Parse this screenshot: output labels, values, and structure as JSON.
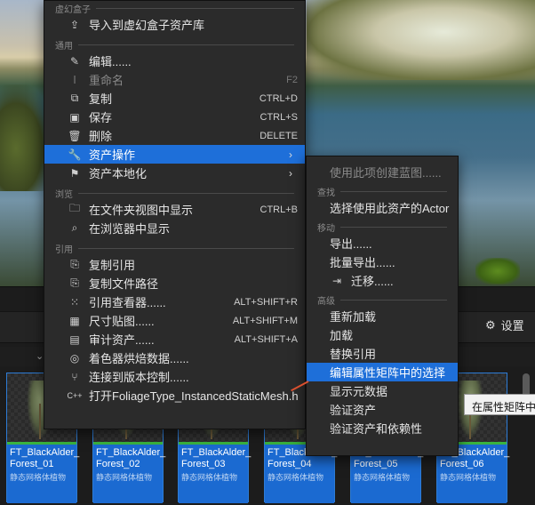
{
  "background": {
    "settings_label": "设置"
  },
  "main_menu": {
    "sections": [
      {
        "title": "虚幻盒子",
        "items": [
          {
            "label": "导入到虚幻盒子资产库",
            "shortcut": "",
            "icon": "import-icon"
          }
        ]
      },
      {
        "title": "通用",
        "items": [
          {
            "label": "编辑......",
            "shortcut": "",
            "icon": "edit-icon"
          },
          {
            "label": "重命名",
            "shortcut": "F2",
            "icon": "rename-icon"
          },
          {
            "label": "复制",
            "shortcut": "CTRL+D",
            "icon": "duplicate-icon"
          },
          {
            "label": "保存",
            "shortcut": "CTRL+S",
            "icon": "save-icon"
          },
          {
            "label": "删除",
            "shortcut": "DELETE",
            "icon": "delete-icon"
          },
          {
            "label": "资产操作",
            "shortcut": "",
            "icon": "wrench-icon"
          },
          {
            "label": "资产本地化",
            "shortcut": "",
            "icon": "flag-icon"
          }
        ]
      },
      {
        "title": "浏览",
        "items": [
          {
            "label": "在文件夹视图中显示",
            "shortcut": "CTRL+B",
            "icon": "folder-search-icon"
          },
          {
            "label": "在浏览器中显示",
            "shortcut": "",
            "icon": "browser-search-icon"
          }
        ]
      },
      {
        "title": "引用",
        "items": [
          {
            "label": "复制引用",
            "shortcut": "",
            "icon": "copy-reference-icon"
          },
          {
            "label": "复制文件路径",
            "shortcut": "",
            "icon": "copy-path-icon"
          },
          {
            "label": "引用查看器......",
            "shortcut": "ALT+SHIFT+R",
            "icon": "reference-viewer-icon"
          },
          {
            "label": "尺寸贴图......",
            "shortcut": "ALT+SHIFT+M",
            "icon": "size-map-icon"
          },
          {
            "label": "审计资产......",
            "shortcut": "ALT+SHIFT+A",
            "icon": "audit-icon"
          },
          {
            "label": "着色器烘焙数据......",
            "shortcut": "",
            "icon": "shader-icon"
          },
          {
            "label": "连接到版本控制......",
            "shortcut": "",
            "icon": "source-control-icon"
          },
          {
            "label": "打开FoliageType_InstancedStaticMesh.h",
            "shortcut": "",
            "icon": "code-file-icon"
          }
        ]
      }
    ]
  },
  "sub_menu": {
    "top_item": "使用此项创建蓝图......",
    "sections": [
      {
        "title": "查找",
        "items": [
          "选择使用此资产的Actor"
        ]
      },
      {
        "title": "移动",
        "items": [
          "导出......",
          "批量导出......",
          "迁移......"
        ]
      },
      {
        "title": "高级",
        "items": [
          "重新加载",
          "加载",
          "替换引用",
          "编辑属性矩阵中的选择",
          "显示元数据",
          "验证资产",
          "验证资产和依赖性"
        ]
      }
    ]
  },
  "tooltip": "在属性矩阵中",
  "assets": [
    {
      "name": "FT_BlackAlder_\nForest_01",
      "type": "静态网格体植物"
    },
    {
      "name": "FT_BlackAlder_\nForest_02",
      "type": "静态网格体植物"
    },
    {
      "name": "FT_BlackAlder_\nForest_03",
      "type": "静态网格体植物"
    },
    {
      "name": "FT_BlackAlder_\nForest_04",
      "type": "静态网格体植物"
    },
    {
      "name": "FT_BlackAlder_\nForest_05",
      "type": "静态网格体植物"
    },
    {
      "name": "FT_BlackAlder_\nForest_06",
      "type": "静态网格体植物"
    }
  ],
  "colors": {
    "selection": "#1e6fd9",
    "menu_bg": "#2b2b2b",
    "asset_tile": "#1b6ad1",
    "pointer": "#d9502f"
  }
}
